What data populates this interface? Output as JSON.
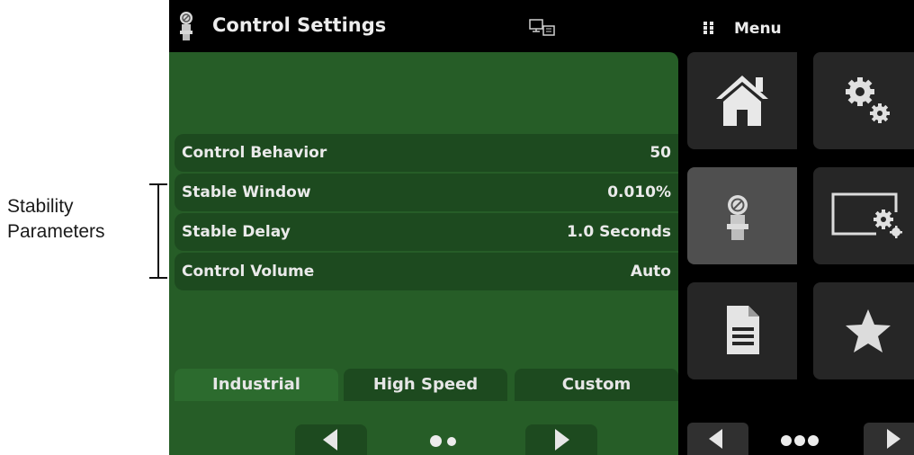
{
  "annotation": {
    "line1": "Stability",
    "line2": "Parameters"
  },
  "topbar": {
    "title": "Control Settings",
    "title_icon": "regulator-icon",
    "remote_icon": "remote-display-icon",
    "menu_icon": "grid-dots-icon",
    "menu_label": "Menu"
  },
  "settings": [
    {
      "label": "Control Behavior",
      "value": "50"
    },
    {
      "label": "Stable Window",
      "value": "0.010%"
    },
    {
      "label": "Stable Delay",
      "value": "1.0 Seconds"
    },
    {
      "label": "Control Volume",
      "value": "Auto"
    }
  ],
  "modes": [
    {
      "label": "Industrial",
      "active": true
    },
    {
      "label": "High Speed",
      "active": false
    },
    {
      "label": "Custom",
      "active": false
    }
  ],
  "panel_nav": {
    "prev_icon": "arrow-left-icon",
    "next_icon": "arrow-right-icon",
    "pages": 2
  },
  "menu_tiles": [
    {
      "icon": "home-icon",
      "active": false
    },
    {
      "icon": "settings-gears-icon",
      "active": false
    },
    {
      "icon": "regulator-icon",
      "active": true
    },
    {
      "icon": "display-settings-icon",
      "active": false
    },
    {
      "icon": "document-icon",
      "active": false
    },
    {
      "icon": "star-icon",
      "active": false
    }
  ],
  "menu_nav": {
    "prev_icon": "arrow-left-icon",
    "next_icon": "arrow-right-icon",
    "pages": 3
  },
  "colors": {
    "panel_green": "#265d27",
    "row_green": "#1d4a1f",
    "tile_gray": "#262626",
    "tile_active": "#4f4f4f"
  }
}
